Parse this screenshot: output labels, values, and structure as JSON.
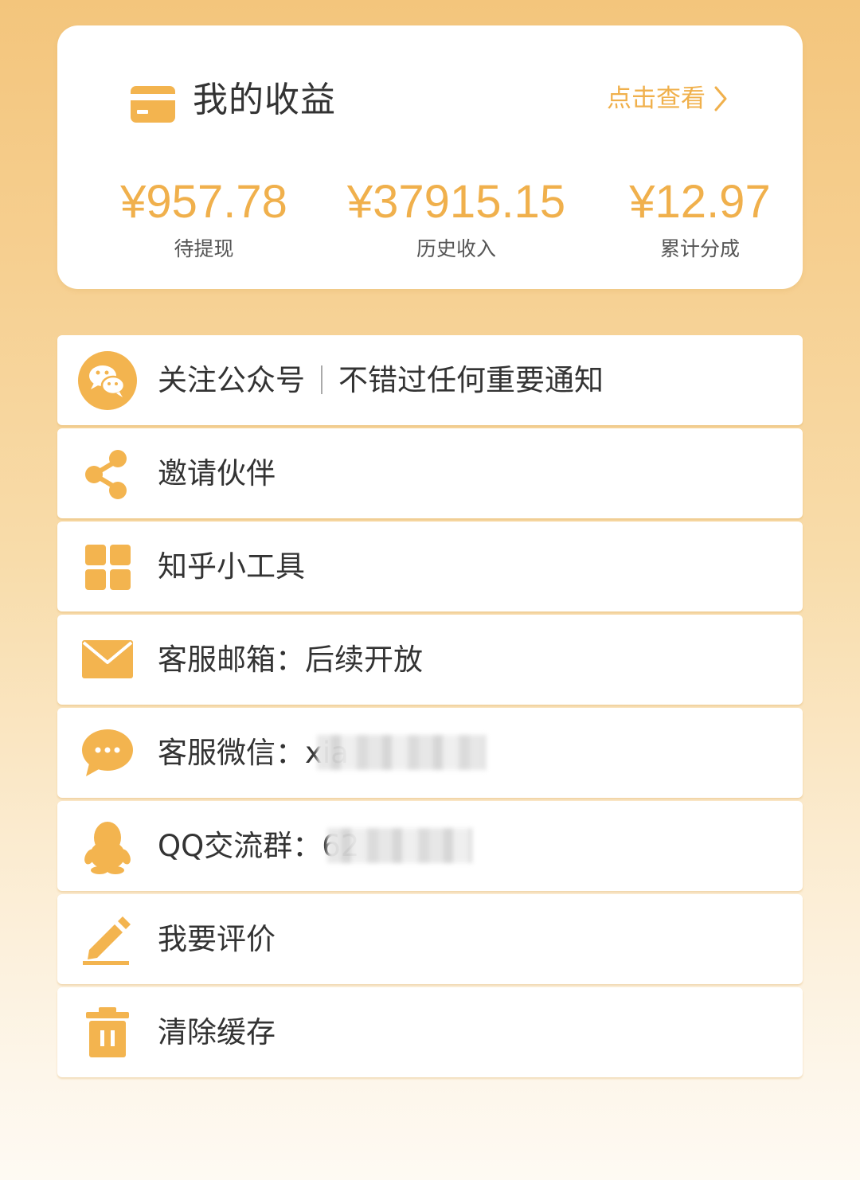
{
  "earnings": {
    "title": "我的收益",
    "view_link": "点击查看",
    "stats": [
      {
        "amount": "¥957.78",
        "label": "待提现"
      },
      {
        "amount": "¥37915.15",
        "label": "历史收入"
      },
      {
        "amount": "¥12.97",
        "label": "累计分成"
      }
    ]
  },
  "menu": {
    "follow": {
      "main": "关注公众号",
      "sub": "不错过任何重要通知",
      "icon": "wechat-icon"
    },
    "invite": {
      "label": "邀请伙伴",
      "icon": "share-icon"
    },
    "tools": {
      "label": "知乎小工具",
      "icon": "grid-icon"
    },
    "email": {
      "label": "客服邮箱：后续开放",
      "icon": "mail-icon"
    },
    "wechat_service": {
      "label": "客服微信：xia",
      "icon": "chat-bubble-icon"
    },
    "qq_group": {
      "label": "QQ交流群：62",
      "icon": "qq-penguin-icon"
    },
    "review": {
      "label": "我要评价",
      "icon": "edit-icon"
    },
    "clear_cache": {
      "label": "清除缓存",
      "icon": "trash-icon"
    }
  },
  "colors": {
    "accent": "#f0b04c",
    "text": "#333333",
    "card": "#ffffff"
  }
}
